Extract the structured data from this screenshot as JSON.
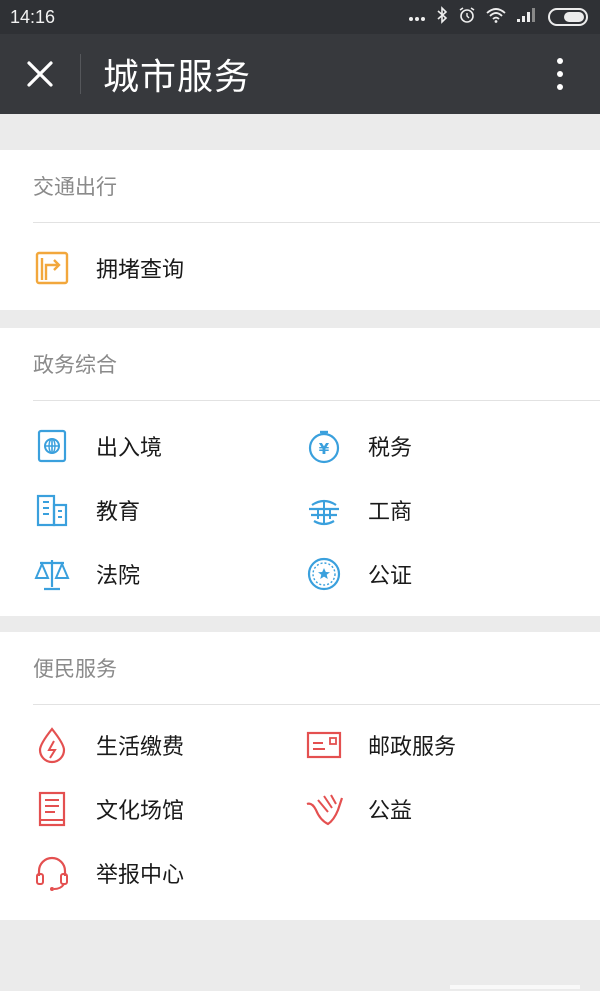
{
  "status_bar": {
    "time": "14:16",
    "icons": [
      "more-dots-icon",
      "bluetooth-icon",
      "alarm-icon",
      "wifi-icon",
      "signal-icon",
      "battery-icon"
    ]
  },
  "nav": {
    "title": "城市服务"
  },
  "colors": {
    "orange": "#f5a623",
    "blue": "#3aa0dd",
    "red": "#e44a4a"
  },
  "sections": [
    {
      "title": "交通出行",
      "items": [
        {
          "label": "拥堵查询",
          "icon": "traffic-sign-icon"
        }
      ]
    },
    {
      "title": "政务综合",
      "items": [
        {
          "label": "出入境",
          "icon": "passport-icon"
        },
        {
          "label": "税务",
          "icon": "tax-icon"
        },
        {
          "label": "教育",
          "icon": "building-icon"
        },
        {
          "label": "工商",
          "icon": "business-icon"
        },
        {
          "label": "法院",
          "icon": "scales-icon"
        },
        {
          "label": "公证",
          "icon": "notary-icon"
        }
      ]
    },
    {
      "title": "便民服务",
      "items": [
        {
          "label": "生活缴费",
          "icon": "water-drop-icon"
        },
        {
          "label": "邮政服务",
          "icon": "postal-icon"
        },
        {
          "label": "文化场馆",
          "icon": "book-icon"
        },
        {
          "label": "公益",
          "icon": "charity-hand-icon"
        },
        {
          "label": "举报中心",
          "icon": "headset-icon"
        }
      ]
    }
  ]
}
